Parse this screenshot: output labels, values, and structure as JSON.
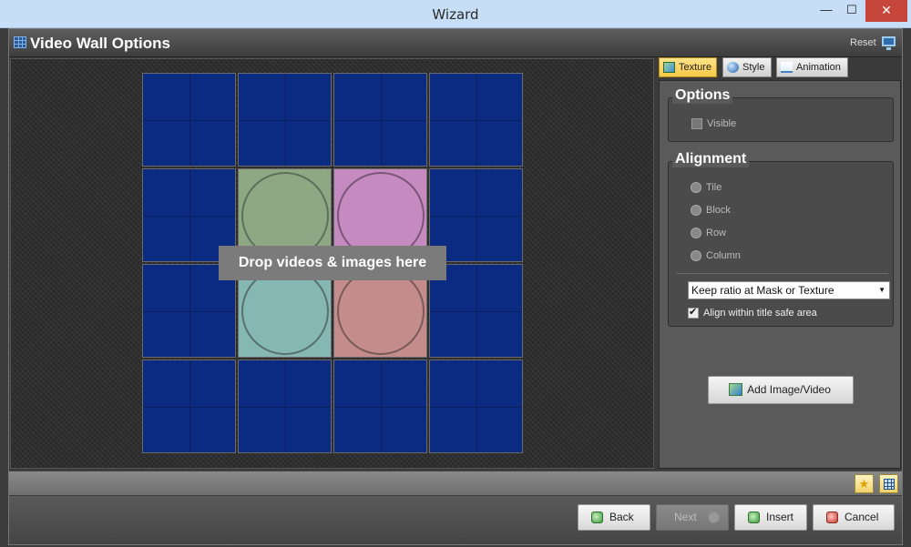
{
  "window": {
    "title": "Wizard",
    "minimize_glyph": "—",
    "maximize_glyph": "☐",
    "close_glyph": "✕"
  },
  "header": {
    "icon": "video-wall-grid-icon",
    "title": "Video Wall Options",
    "reset_label": "Reset",
    "monitor_icon": "monitor-icon"
  },
  "canvas": {
    "drop_hint": "Drop videos & images here",
    "tile_color": "#0b2b83"
  },
  "tabs": [
    {
      "label": "Texture",
      "icon": "texture-icon",
      "active": true
    },
    {
      "label": "Style",
      "icon": "style-globe-icon",
      "active": false
    },
    {
      "label": "Animation",
      "icon": "animation-icon",
      "active": false
    }
  ],
  "options_group": {
    "title": "Options",
    "visible_label": "Visible",
    "visible_checked": false
  },
  "alignment_group": {
    "title": "Alignment",
    "radios": [
      "Tile",
      "Block",
      "Row",
      "Column"
    ],
    "ratio_select": "Keep ratio at Mask or Texture",
    "safe_area_label": "Align within title safe area",
    "safe_area_checked": true
  },
  "add_button": "Add Image/Video",
  "status_buttons": [
    "favorite-star-icon",
    "grid-view-icon"
  ],
  "footer": {
    "back": "Back",
    "next": "Next",
    "insert": "Insert",
    "cancel": "Cancel"
  },
  "colors": {
    "active_tab": "#f5c945",
    "close_button": "#c7463b"
  }
}
